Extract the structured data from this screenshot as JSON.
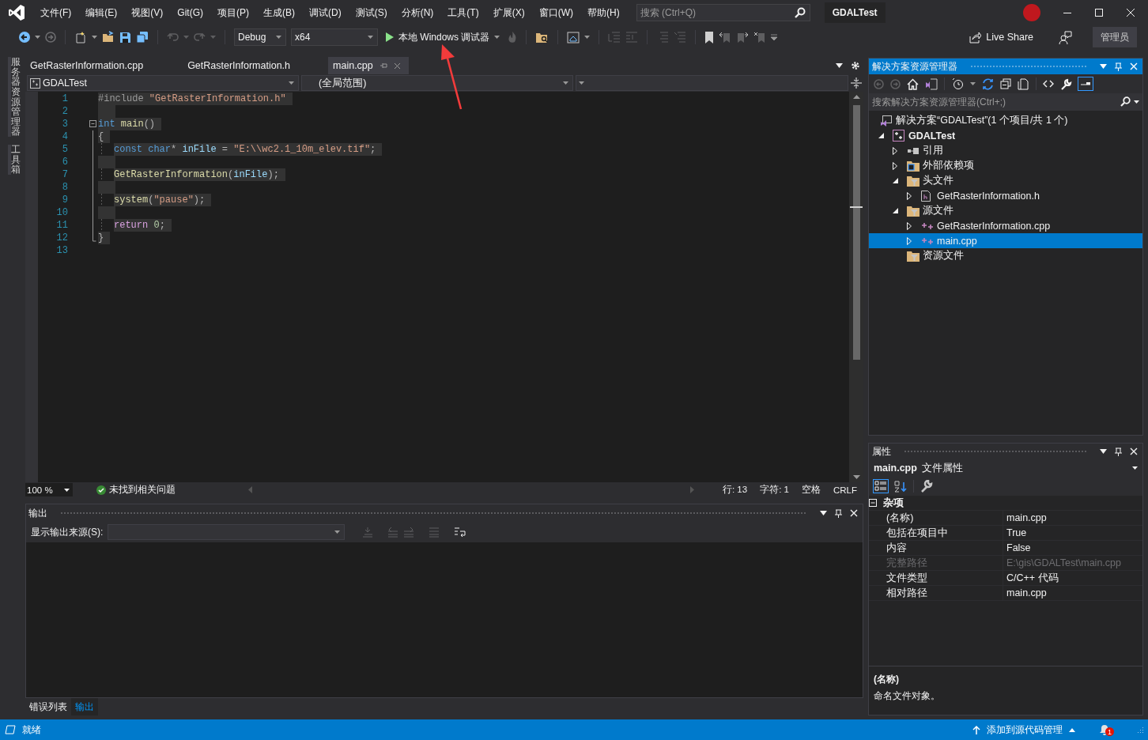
{
  "title_bar": {
    "menu": [
      "文件(F)",
      "编辑(E)",
      "视图(V)",
      "Git(G)",
      "项目(P)",
      "生成(B)",
      "调试(D)",
      "测试(S)",
      "分析(N)",
      "工具(T)",
      "扩展(X)",
      "窗口(W)",
      "帮助(H)"
    ],
    "search": {
      "placeholder": "搜索 (Ctrl+Q)"
    },
    "solution_name": "GDALTest"
  },
  "toolbar": {
    "configuration": "Debug",
    "platform": "x64",
    "run_label": "本地 Windows 调试器",
    "live_share": "Live Share",
    "role": "管理员"
  },
  "side_tabs": [
    "服务器资源管理器",
    "工具箱"
  ],
  "editor": {
    "tabs": [
      {
        "label": "GetRasterInformation.cpp",
        "selected": false
      },
      {
        "label": "GetRasterInformation.h",
        "selected": false
      },
      {
        "label": "main.cpp",
        "selected": true
      }
    ],
    "project": "GDALTest",
    "scope": "(全局范围)",
    "lines": [
      {
        "number": "1",
        "selected": true,
        "kind": "plain",
        "indented": false,
        "tokens": [
          {
            "text": "#include ",
            "kind": "preproc"
          },
          {
            "text": "\"GetRasterInformation.h\"",
            "kind": "string"
          }
        ]
      },
      {
        "number": "2",
        "selected": true,
        "kind": "plain",
        "indented": false
      },
      {
        "number": "3",
        "selected": true,
        "kind": "foldstart",
        "indented": false,
        "tokens": [
          {
            "text": "int ",
            "kind": "keyword"
          },
          {
            "text": "main",
            "kind": "function"
          },
          {
            "text": "()",
            "kind": "punct"
          }
        ]
      },
      {
        "number": "4",
        "selected": true,
        "kind": "foldbody",
        "indented": false,
        "tokens": [
          {
            "text": "{",
            "kind": "punct"
          }
        ]
      },
      {
        "number": "5",
        "selected": true,
        "kind": "foldbody",
        "indented": true,
        "tokens": [
          {
            "text": "const ",
            "kind": "keyword"
          },
          {
            "text": "char",
            "kind": "keyword"
          },
          {
            "text": "* ",
            "kind": "punct"
          },
          {
            "text": "inFile",
            "kind": "variable"
          },
          {
            "text": " = ",
            "kind": "punct"
          },
          {
            "text": "\"E:\\\\wc2.1_10m_elev.tif\"",
            "kind": "string"
          },
          {
            "text": ";",
            "kind": "punct"
          }
        ]
      },
      {
        "number": "6",
        "selected": true,
        "kind": "foldbody",
        "indented": false
      },
      {
        "number": "7",
        "selected": true,
        "kind": "foldbody",
        "indented": true,
        "tokens": [
          {
            "text": "GetRasterInformation",
            "kind": "function"
          },
          {
            "text": "(",
            "kind": "punct"
          },
          {
            "text": "inFile",
            "kind": "variable"
          },
          {
            "text": ");",
            "kind": "punct"
          }
        ]
      },
      {
        "number": "8",
        "selected": true,
        "kind": "foldbody",
        "indented": false
      },
      {
        "number": "9",
        "selected": true,
        "kind": "foldbody",
        "indented": true,
        "tokens": [
          {
            "text": "system",
            "kind": "function"
          },
          {
            "text": "(",
            "kind": "punct"
          },
          {
            "text": "\"pause\"",
            "kind": "string"
          },
          {
            "text": ");",
            "kind": "punct"
          }
        ]
      },
      {
        "number": "10",
        "selected": true,
        "kind": "foldbody",
        "indented": false
      },
      {
        "number": "11",
        "selected": true,
        "kind": "foldbody",
        "indented": true,
        "tokens": [
          {
            "text": "return ",
            "kind": "control"
          },
          {
            "text": "0",
            "kind": "number"
          },
          {
            "text": ";",
            "kind": "punct"
          }
        ]
      },
      {
        "number": "12",
        "selected": true,
        "kind": "foldend",
        "indented": false,
        "tokens": [
          {
            "text": "}",
            "kind": "punct"
          }
        ]
      },
      {
        "number": "13",
        "selected": false,
        "kind": "plain"
      }
    ],
    "zoom": "100 %",
    "issues": "未找到相关问题",
    "position": [
      "行: 13",
      "字符: 1",
      "空格",
      "CRLF"
    ]
  },
  "output": {
    "title": "输出",
    "source_label": "显示输出来源(S):"
  },
  "bottom_tabs": [
    {
      "label": "错误列表",
      "selected": false
    },
    {
      "label": "输出",
      "selected": true
    }
  ],
  "solution_explorer": {
    "title": "解决方案资源管理器",
    "search": {
      "placeholder": "搜索解决方案资源管理器(Ctrl+;)"
    },
    "tree": [
      {
        "label": "解决方案“GDALTest”(1 个项目/共 1 个)",
        "kind": "solution",
        "selected": false,
        "children": [
          {
            "label": "GDALTest",
            "kind": "project",
            "expandable": true,
            "expanded": true,
            "selected": false,
            "children": [
              {
                "label": "引用",
                "kind": "references",
                "expandable": true,
                "expanded": false,
                "selected": false
              },
              {
                "label": "外部依赖项",
                "kind": "external",
                "expandable": true,
                "expanded": false,
                "selected": false
              },
              {
                "label": "头文件",
                "kind": "filter",
                "expandable": true,
                "expanded": true,
                "selected": false,
                "children": [
                  {
                    "label": "GetRasterInformation.h",
                    "kind": "header",
                    "expandable": true,
                    "expanded": false,
                    "selected": false
                  }
                ]
              },
              {
                "label": "源文件",
                "kind": "filter",
                "expandable": true,
                "expanded": true,
                "selected": false,
                "children": [
                  {
                    "label": "GetRasterInformation.cpp",
                    "kind": "source",
                    "expandable": true,
                    "expanded": false,
                    "selected": false
                  },
                  {
                    "label": "main.cpp",
                    "kind": "source",
                    "expandable": true,
                    "expanded": false,
                    "selected": true
                  }
                ]
              },
              {
                "label": "资源文件",
                "kind": "filter",
                "expandable": false,
                "selected": false
              }
            ]
          }
        ]
      }
    ]
  },
  "properties": {
    "title": "属性",
    "object": "main.cpp",
    "object_type": "文件属性",
    "category": "杂项",
    "rows": [
      {
        "name": "(名称)",
        "value": "main.cpp",
        "disabled": false
      },
      {
        "name": "包括在项目中",
        "value": "True",
        "disabled": false
      },
      {
        "name": "内容",
        "value": "False",
        "disabled": false
      },
      {
        "name": "完整路径",
        "value": "E:\\gis\\GDALTest\\main.cpp",
        "disabled": true
      },
      {
        "name": "文件类型",
        "value": "C/C++ 代码",
        "disabled": false
      },
      {
        "name": "相对路径",
        "value": "main.cpp",
        "disabled": false
      }
    ],
    "description": {
      "title": "(名称)",
      "text": "命名文件对象。"
    }
  },
  "status_bar": {
    "status": "就绪",
    "source_control": "添加到源代码管理",
    "notifications": "1"
  }
}
